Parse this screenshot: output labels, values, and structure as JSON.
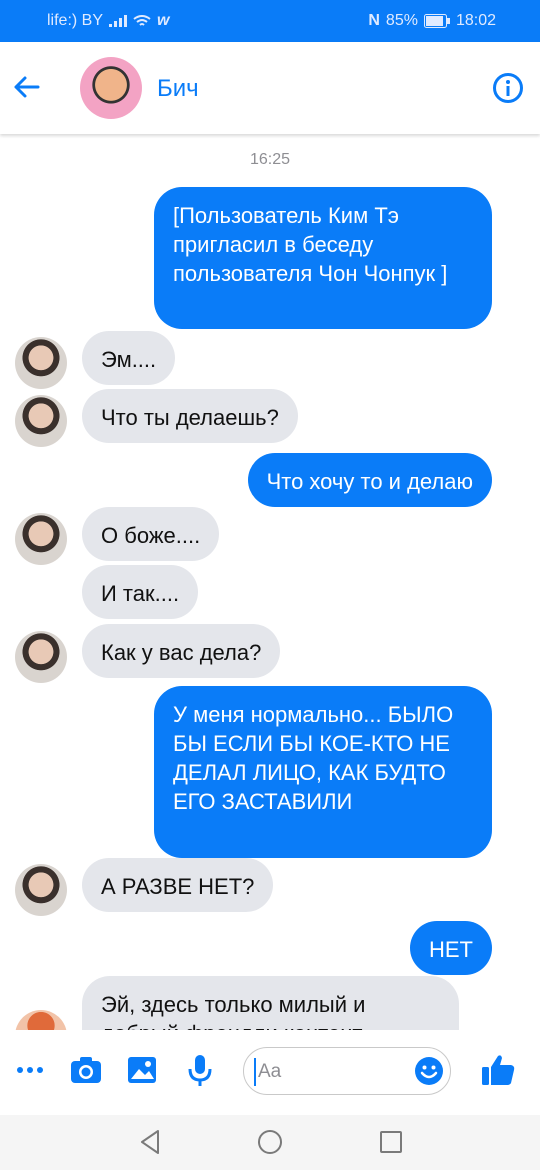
{
  "status": {
    "carrier": "life:) BY",
    "battery": "85%",
    "time": "18:02"
  },
  "header": {
    "title": "Бич"
  },
  "chat": {
    "timestamp": "16:25",
    "messages": [
      {
        "dir": "out",
        "text": "[Пользователь Ким Тэ пригласил в беседу пользователя Чон Чонпук ]"
      },
      {
        "dir": "in",
        "text": "Эм...."
      },
      {
        "dir": "in",
        "text": "Что ты делаешь?"
      },
      {
        "dir": "out",
        "text": "Что хочу то и делаю"
      },
      {
        "dir": "in",
        "text": "О боже...."
      },
      {
        "dir": "in",
        "text": "И так...."
      },
      {
        "dir": "in",
        "text": "Как у вас дела?"
      },
      {
        "dir": "out",
        "text": "У меня нормально... БЫЛО БЫ ЕСЛИ БЫ КОЕ-КТО НЕ ДЕЛАЛ ЛИЦО, КАК БУДТО ЕГО ЗАСТАВИЛИ"
      },
      {
        "dir": "in",
        "text": "А РАЗВЕ НЕТ?"
      },
      {
        "dir": "out",
        "text": "НЕТ"
      },
      {
        "dir": "in",
        "text": "Эй, здесь только милый и добрый френдли контент"
      }
    ]
  },
  "composer": {
    "placeholder": "Aa"
  },
  "colors": {
    "accent": "#0a7cf8",
    "incoming_bubble": "#e4e6eb"
  }
}
